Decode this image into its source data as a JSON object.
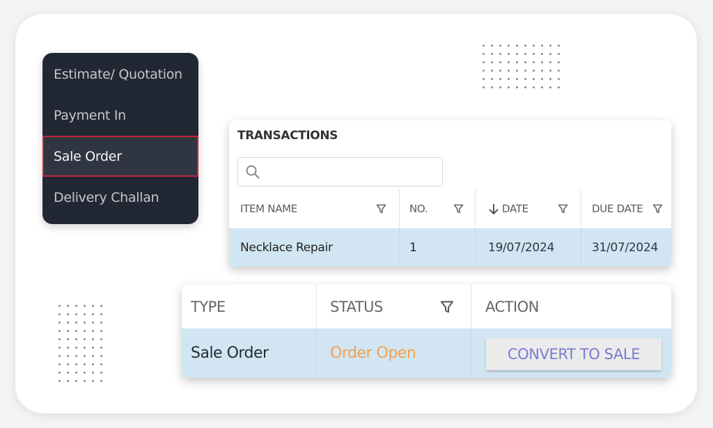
{
  "menu": {
    "items": [
      {
        "label": "Estimate/ Quotation",
        "active": false
      },
      {
        "label": "Payment In",
        "active": false
      },
      {
        "label": "Sale Order",
        "active": true
      },
      {
        "label": "Delivery Challan",
        "active": false
      }
    ]
  },
  "transactions": {
    "title": "TRANSACTIONS",
    "search": {
      "placeholder": "",
      "value": "",
      "icon": "search-icon"
    },
    "columns": [
      {
        "label": "ITEM NAME",
        "filter_icon": "filter-icon"
      },
      {
        "label": "NO.",
        "filter_icon": "filter-icon"
      },
      {
        "label": "DATE",
        "sort_icon": "arrow-down-icon",
        "filter_icon": "filter-icon"
      },
      {
        "label": "DUE DATE",
        "filter_icon": "filter-icon"
      }
    ],
    "rows": [
      {
        "item_name": "Necklace Repair",
        "no": "1",
        "date": "19/07/2024",
        "due_date": "31/07/2024"
      }
    ]
  },
  "order": {
    "columns": [
      {
        "label": "TYPE"
      },
      {
        "label": "STATUS",
        "filter_icon": "filter-icon"
      },
      {
        "label": "ACTION"
      }
    ],
    "rows": [
      {
        "type": "Sale Order",
        "status": "Order Open",
        "action_label": "CONVERT TO SALE"
      }
    ]
  },
  "colors": {
    "menu_bg": "#222833",
    "menu_active_border": "#c4243a",
    "row_highlight": "#d1e6f2",
    "status_open": "#f1a24c",
    "action_text": "#7b7bd0"
  }
}
